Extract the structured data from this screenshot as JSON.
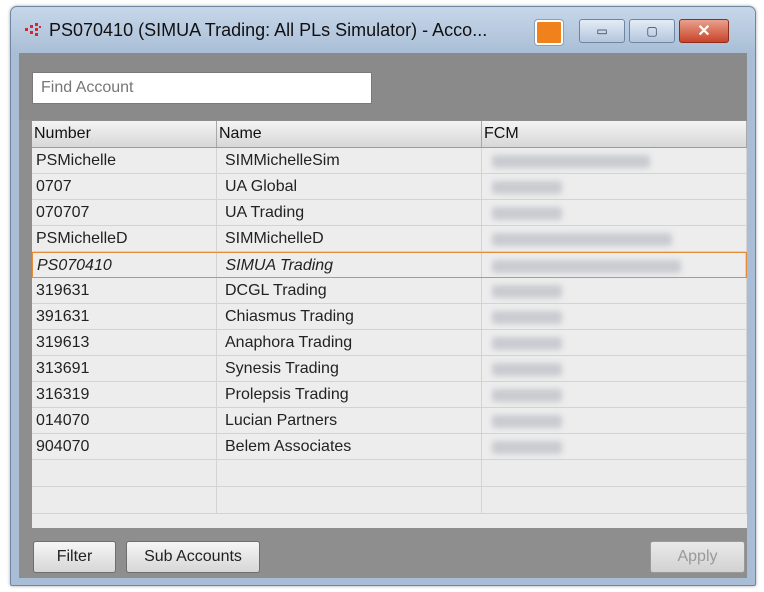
{
  "window": {
    "title": "PS070410 (SIMUA Trading: All PLs Simulator) - Acco...",
    "orange_color": "#f0821e",
    "controls": {
      "minimize": "▭",
      "maximize": "▢",
      "close": "✕"
    }
  },
  "search": {
    "placeholder": "Find Account",
    "value": ""
  },
  "grid": {
    "columns": [
      "Number",
      "Name",
      "FCM"
    ],
    "rows": [
      {
        "number": "PSMichelle",
        "name": "SIMMichelleSim",
        "fcm": "",
        "selected": false
      },
      {
        "number": "0707",
        "name": "UA Global",
        "fcm": "",
        "selected": false
      },
      {
        "number": "070707",
        "name": "UA Trading",
        "fcm": "",
        "selected": false
      },
      {
        "number": "PSMichelleD",
        "name": "SIMMichelleD",
        "fcm": "",
        "selected": false
      },
      {
        "number": "PS070410",
        "name": "SIMUA Trading",
        "fcm": "",
        "selected": true
      },
      {
        "number": "319631",
        "name": "DCGL Trading",
        "fcm": "",
        "selected": false
      },
      {
        "number": "391631",
        "name": "Chiasmus Trading",
        "fcm": "",
        "selected": false
      },
      {
        "number": "319613",
        "name": "Anaphora Trading",
        "fcm": "",
        "selected": false
      },
      {
        "number": "313691",
        "name": "Synesis Trading",
        "fcm": "",
        "selected": false
      },
      {
        "number": "316319",
        "name": "Prolepsis Trading",
        "fcm": "",
        "selected": false
      },
      {
        "number": "014070",
        "name": "Lucian Partners",
        "fcm": "",
        "selected": false
      },
      {
        "number": "904070",
        "name": "Belem Associates",
        "fcm": "",
        "selected": false
      }
    ]
  },
  "buttons": {
    "filter": "Filter",
    "sub_accounts": "Sub Accounts",
    "apply": "Apply"
  }
}
